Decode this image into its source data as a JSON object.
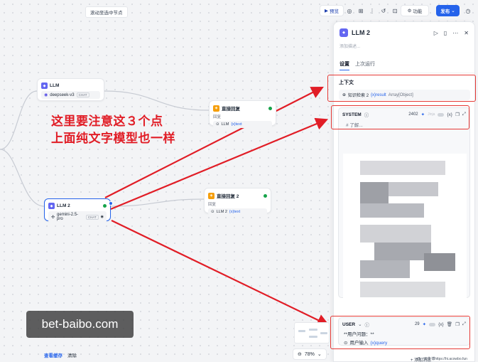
{
  "top_hint": "滚动至选中节点",
  "toolbar": {
    "preview_label": "预览",
    "features_label": "功能",
    "publish_label": "发布"
  },
  "nodes": {
    "llm1": {
      "title": "LLM",
      "model": "deepseek-v3",
      "model_tag": "CHAT"
    },
    "llm2": {
      "title": "LLM 2",
      "model": "gemini-2.5-pro",
      "model_tag": "CHAT"
    },
    "answer1": {
      "title": "直接回复",
      "field_label": "回复",
      "ref_node": "LLM",
      "ref_var": "{x}text"
    },
    "answer2": {
      "title": "直接回复 2",
      "field_label": "回复",
      "ref_node": "LLM 2",
      "ref_var": "{x}text"
    }
  },
  "annotation": {
    "line1": "这里要注意这３个点",
    "line2": "上面纯文字模型也一样"
  },
  "watermark": "bet-baibo.com",
  "bottom_bar": {
    "view_cache": "查看缓存",
    "clear": "清除",
    "zoom": "78%"
  },
  "panel": {
    "title": "LLM 2",
    "description_placeholder": "添加描述...",
    "tabs": [
      "设置",
      "上次运行"
    ],
    "context": {
      "title": "上下文",
      "source_node": "知识检索 2",
      "var": "{x}result",
      "type": "Array[Object]"
    },
    "system": {
      "label": "SYSTEM",
      "count": "2402",
      "jinja": "Jinja",
      "preview_text": "# 了解..."
    },
    "user": {
      "label": "USER",
      "count": "29",
      "line1": "**用户问题：**",
      "node": "用户输入",
      "var": "{x}query"
    },
    "add_message": "+ 添加消息",
    "credit": "@一只牛博https://hi.acowbo.fun"
  },
  "colors": {
    "accent": "#2563eb",
    "annotation_red": "#e11d26",
    "success": "#16a34a"
  }
}
